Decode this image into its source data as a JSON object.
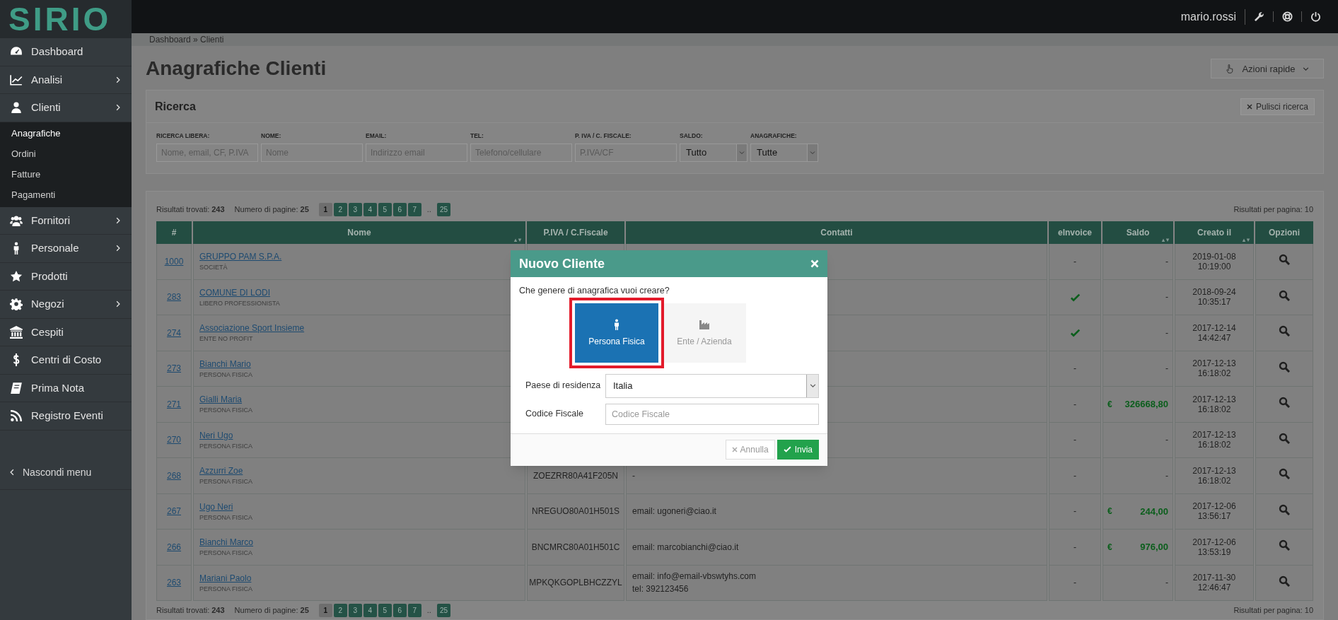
{
  "logo": "SIRIO",
  "topbar": {
    "user": "mario.rossi"
  },
  "sidebar": {
    "items": [
      {
        "label": "Dashboard",
        "has_arrow": false
      },
      {
        "label": "Analisi",
        "has_arrow": true
      },
      {
        "label": "Clienti",
        "has_arrow": true,
        "expanded": true,
        "children": [
          {
            "label": "Anagrafiche",
            "selected": true
          },
          {
            "label": "Ordini",
            "selected": false
          },
          {
            "label": "Fatture",
            "selected": false
          },
          {
            "label": "Pagamenti",
            "selected": false
          }
        ]
      },
      {
        "label": "Fornitori",
        "has_arrow": true
      },
      {
        "label": "Personale",
        "has_arrow": true
      },
      {
        "label": "Prodotti",
        "has_arrow": false
      },
      {
        "label": "Negozi",
        "has_arrow": true
      },
      {
        "label": "Cespiti",
        "has_arrow": false
      },
      {
        "label": "Centri di Costo",
        "has_arrow": false
      },
      {
        "label": "Prima Nota",
        "has_arrow": false
      },
      {
        "label": "Registro Eventi",
        "has_arrow": false
      }
    ],
    "hide_menu": "Nascondi menu"
  },
  "breadcrumb": "Dashboard » Clienti",
  "title": "Anagrafiche Clienti",
  "quick_actions": "Azioni rapide",
  "search": {
    "title": "Ricerca",
    "clear": "Pulisci ricerca",
    "fields": [
      {
        "kind": "input",
        "label": "RICERCA LIBERA:",
        "placeholder": "Nome, email, CF, P.IVA"
      },
      {
        "kind": "input",
        "label": "NOME:",
        "placeholder": "Nome"
      },
      {
        "kind": "input",
        "label": "EMAIL:",
        "placeholder": "Indirizzo email"
      },
      {
        "kind": "input",
        "label": "TEL:",
        "placeholder": "Telefono/cellulare"
      },
      {
        "kind": "input",
        "label": "P. IVA / C. FISCALE:",
        "placeholder": "P.IVA/CF"
      },
      {
        "kind": "select",
        "label": "SALDO:",
        "value": "Tutto"
      },
      {
        "kind": "select",
        "label": "ANAGRAFICHE:",
        "value": "Tutte"
      }
    ]
  },
  "results_top": {
    "found_label": "Risultati trovati:",
    "found": "243",
    "pages_label": "Numero di pagine:",
    "pages": "25",
    "per_page": "Risultati per pagina: 10",
    "pagination": [
      {
        "label": "1",
        "selected": true
      },
      {
        "label": "2",
        "selected": false
      },
      {
        "label": "3",
        "selected": false
      },
      {
        "label": "4",
        "selected": false
      },
      {
        "label": "5",
        "selected": false
      },
      {
        "label": "6",
        "selected": false
      },
      {
        "label": "7",
        "selected": false
      },
      {
        "label": "..",
        "kind": "gap"
      },
      {
        "label": "25",
        "selected": false
      }
    ]
  },
  "table": {
    "columns": [
      {
        "label": "#",
        "sortable": false
      },
      {
        "label": "Nome",
        "sortable": true
      },
      {
        "label": "P.IVA / C.Fiscale",
        "sortable": false
      },
      {
        "label": "Contatti",
        "sortable": false
      },
      {
        "label": "eInvoice",
        "sortable": false
      },
      {
        "label": "Saldo",
        "sortable": true
      },
      {
        "label": "Creato il",
        "sortable": true
      },
      {
        "label": "Opzioni",
        "sortable": false
      }
    ],
    "rows": [
      {
        "id": "1000",
        "name": "GRUPPO PAM S.P.A.",
        "type": "SOCIETÀ",
        "einvoice_check": false,
        "einvoice": "-",
        "saldo": "-",
        "date": "2019-01-08",
        "time": "10:19:00"
      },
      {
        "id": "283",
        "name": "COMUNE DI LODI",
        "type": "LIBERO PROFESSIONISTA",
        "einvoice_check": true,
        "saldo": "-",
        "date": "2018-09-24",
        "time": "10:35:17"
      },
      {
        "id": "274",
        "name": "Associazione Sport Insieme",
        "type": "ENTE NO PROFIT",
        "einvoice_check": true,
        "saldo": "-",
        "date": "2017-12-14",
        "time": "14:42:47"
      },
      {
        "id": "273",
        "name": "Bianchi Mario",
        "type": "PERSONA FISICA",
        "einvoice_check": false,
        "einvoice": "-",
        "saldo": "-",
        "date": "2017-12-13",
        "time": "16:18:02"
      },
      {
        "id": "271",
        "name": "Gialli Maria",
        "type": "PERSONA FISICA",
        "einvoice_check": false,
        "einvoice": "-",
        "saldo_currency": "€",
        "saldo": "326668,80",
        "date": "2017-12-13",
        "time": "16:18:02"
      },
      {
        "id": "270",
        "name": "Neri Ugo",
        "type": "PERSONA FISICA",
        "einvoice_check": false,
        "einvoice": "-",
        "saldo": "-",
        "date": "2017-12-13",
        "time": "16:18:02"
      },
      {
        "id": "268",
        "name": "Azzurri Zoe",
        "type": "PERSONA FISICA",
        "piva": "ZOEZRR80A41F205N",
        "contacts": [
          "-"
        ],
        "einvoice_check": false,
        "einvoice": "-",
        "saldo": "-",
        "date": "2017-12-13",
        "time": "16:18:02"
      },
      {
        "id": "267",
        "name": "Ugo Neri",
        "type": "PERSONA FISICA",
        "piva": "NREGUO80A01H501S",
        "contacts": [
          "email: ugoneri@ciao.it"
        ],
        "einvoice_check": false,
        "einvoice": "-",
        "saldo_currency": "€",
        "saldo": "244,00",
        "date": "2017-12-06",
        "time": "13:56:17"
      },
      {
        "id": "266",
        "name": "Bianchi Marco",
        "type": "PERSONA FISICA",
        "piva": "BNCMRC80A01H501C",
        "contacts": [
          "email: marcobianchi@ciao.it"
        ],
        "einvoice_check": false,
        "einvoice": "-",
        "saldo_currency": "€",
        "saldo": "976,00",
        "date": "2017-12-06",
        "time": "13:53:19"
      },
      {
        "id": "263",
        "name": "Mariani Paolo",
        "type": "PERSONA FISICA",
        "piva": "MPKQKGOPLBHCZZYL",
        "contacts": [
          "email: info@email-vbswtyhs.com",
          "tel: 392123456"
        ],
        "einvoice_check": false,
        "einvoice": "-",
        "saldo": "-",
        "date": "2017-11-30",
        "time": "12:46:47"
      }
    ]
  },
  "results_bottom": {
    "found_label": "Risultati trovati:",
    "found": "243",
    "pages_label": "Numero di pagine:",
    "pages": "25",
    "per_page": "Risultati per pagina: 10",
    "pagination": [
      {
        "label": "1",
        "selected": true
      },
      {
        "label": "2",
        "selected": false
      },
      {
        "label": "3",
        "selected": false
      },
      {
        "label": "4",
        "selected": false
      },
      {
        "label": "5",
        "selected": false
      },
      {
        "label": "6",
        "selected": false
      },
      {
        "label": "7",
        "selected": false
      },
      {
        "label": "..",
        "kind": "gap"
      },
      {
        "label": "25",
        "selected": false
      }
    ]
  },
  "modal": {
    "title": "Nuovo Cliente",
    "question": "Che genere di anagrafica vuoi creare?",
    "options": [
      {
        "label": "Persona Fisica",
        "selected": true
      },
      {
        "label": "Ente / Azienda",
        "selected": false
      }
    ],
    "fields": [
      {
        "kind": "select",
        "label": "Paese di residenza",
        "value": "Italia"
      },
      {
        "kind": "input",
        "label": "Codice Fiscale",
        "placeholder": "Codice Fiscale"
      }
    ],
    "cancel": "Annulla",
    "submit": "Invia"
  }
}
